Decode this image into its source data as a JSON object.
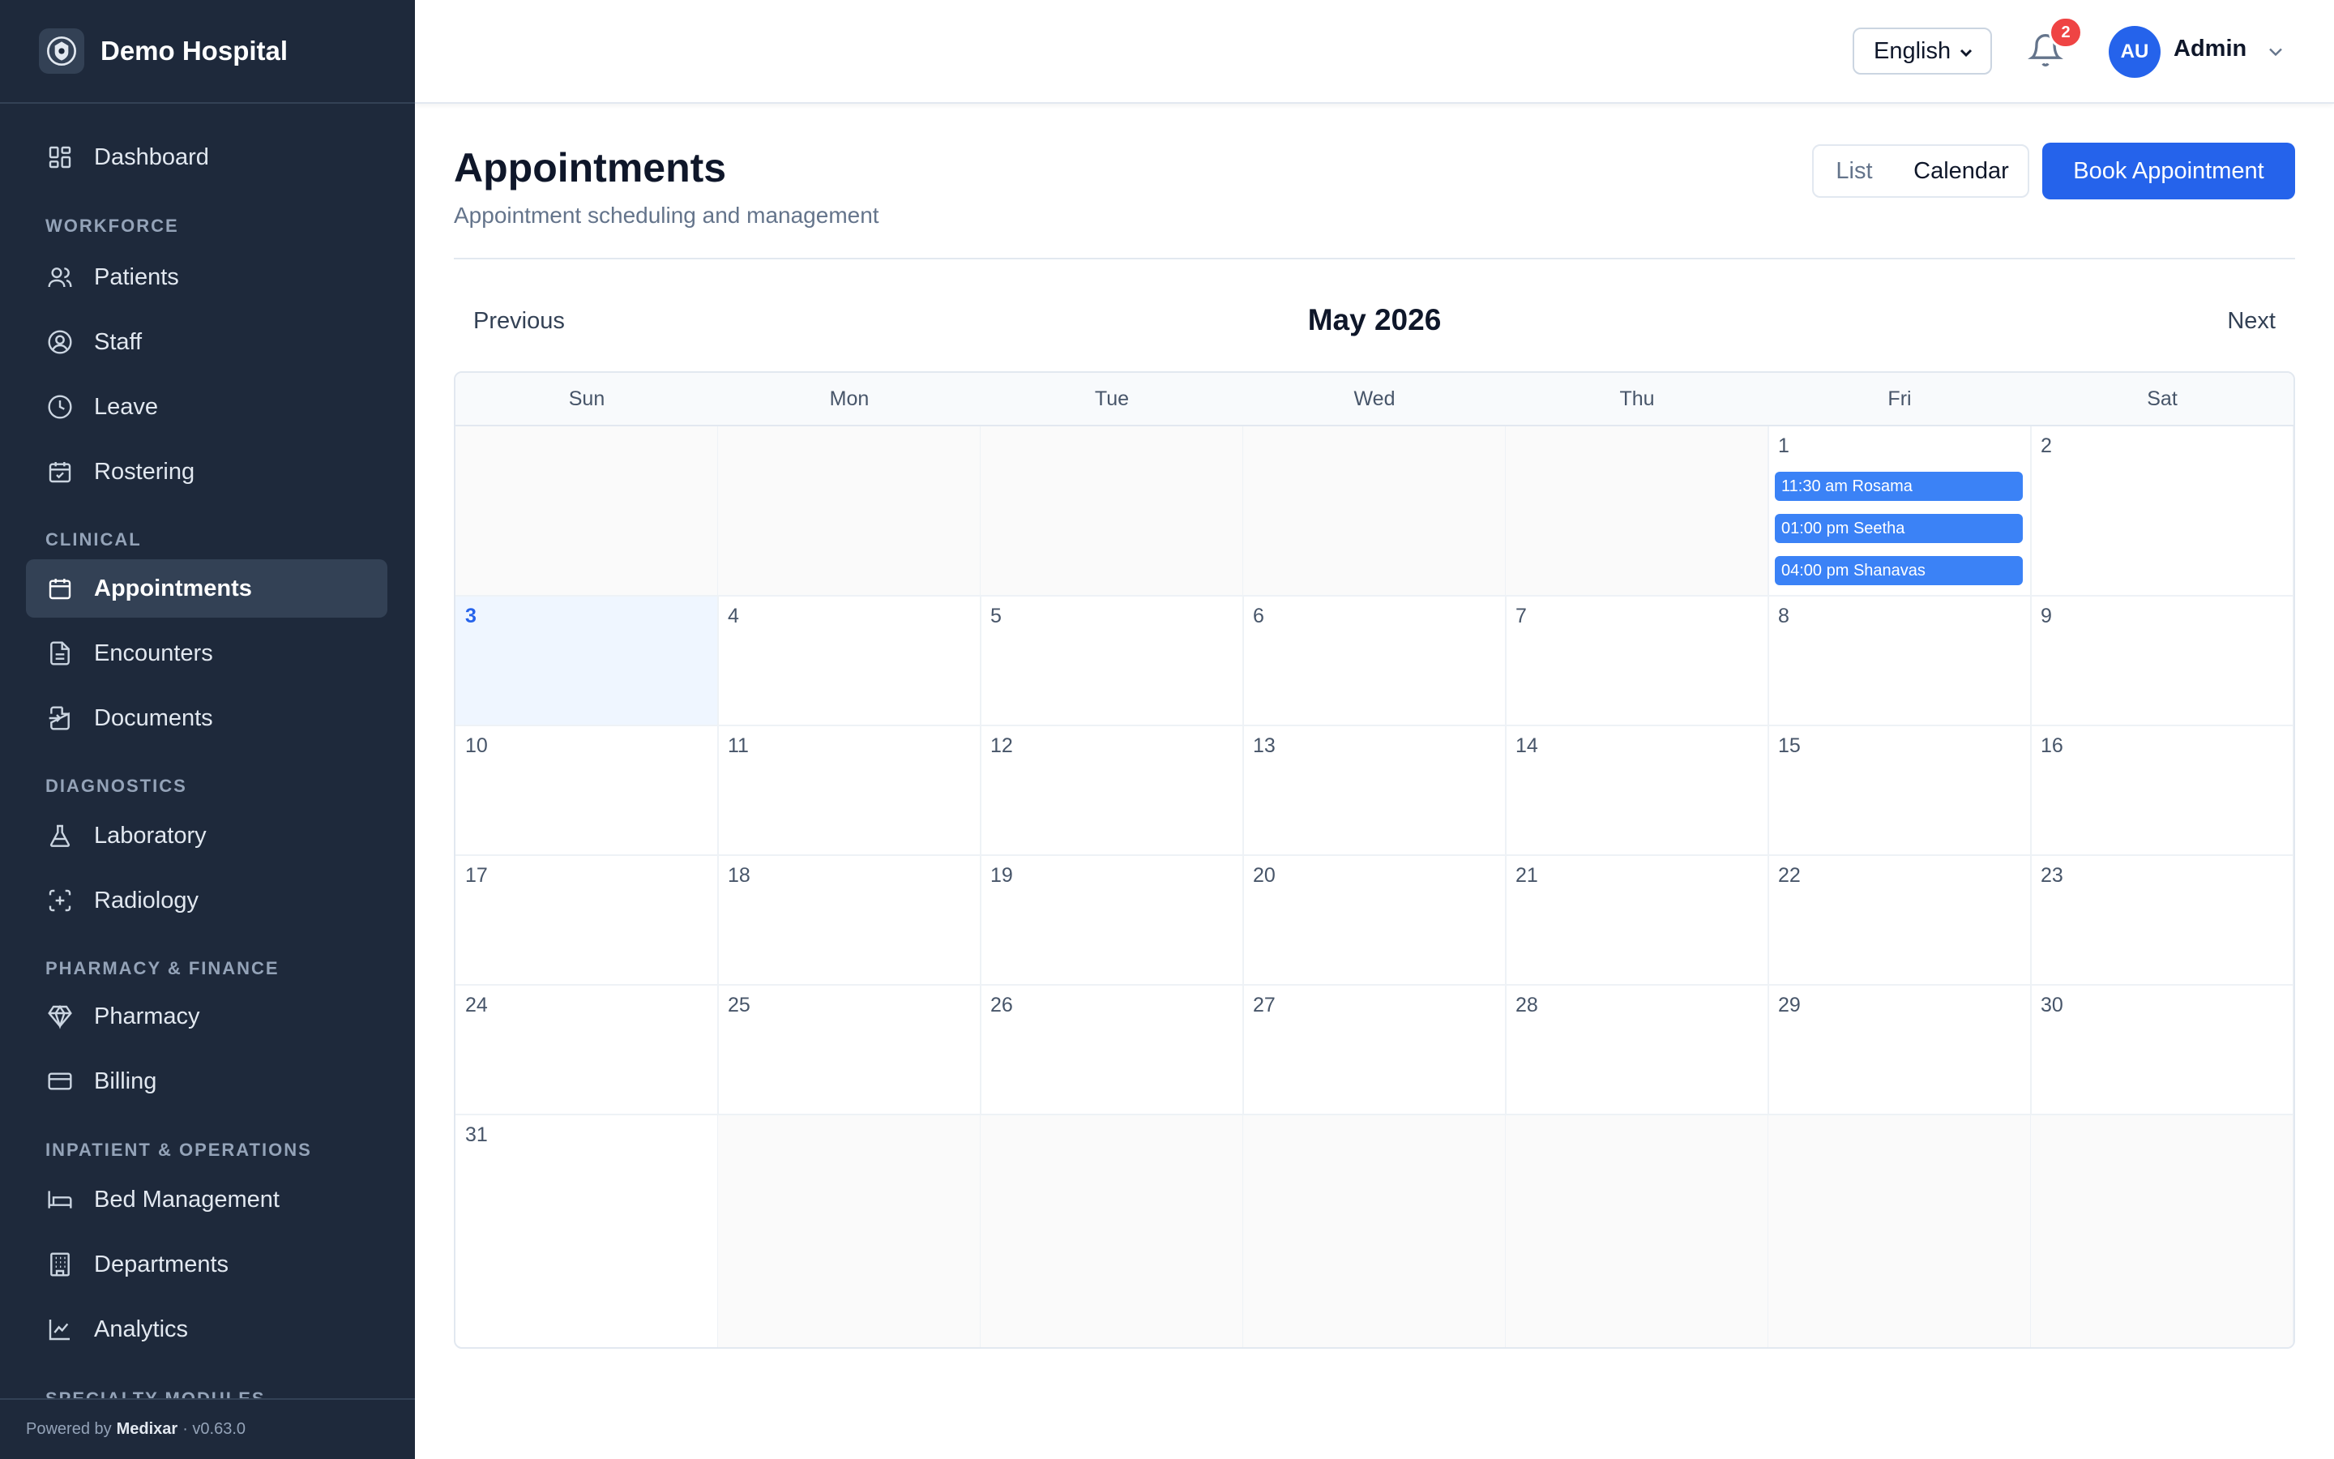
{
  "brand": {
    "name": "Demo Hospital"
  },
  "sidebar": {
    "items": [
      {
        "id": "dashboard",
        "label": "Dashboard",
        "icon": "grid-icon"
      },
      {
        "id": "patients",
        "label": "Patients",
        "icon": "users-icon"
      },
      {
        "id": "staff",
        "label": "Staff",
        "icon": "user-circle-icon"
      },
      {
        "id": "leave",
        "label": "Leave",
        "icon": "clock-icon"
      },
      {
        "id": "rostering",
        "label": "Rostering",
        "icon": "calendar-check-icon"
      },
      {
        "id": "appointments",
        "label": "Appointments",
        "icon": "calendar-icon",
        "active": true
      },
      {
        "id": "encounters",
        "label": "Encounters",
        "icon": "file-text-icon"
      },
      {
        "id": "documents",
        "label": "Documents",
        "icon": "file-import-icon"
      },
      {
        "id": "laboratory",
        "label": "Laboratory",
        "icon": "flask-icon"
      },
      {
        "id": "radiology",
        "label": "Radiology",
        "icon": "scan-icon"
      },
      {
        "id": "pharmacy",
        "label": "Pharmacy",
        "icon": "gem-icon"
      },
      {
        "id": "billing",
        "label": "Billing",
        "icon": "credit-card-icon"
      },
      {
        "id": "bed-management",
        "label": "Bed Management",
        "icon": "bed-icon"
      },
      {
        "id": "departments",
        "label": "Departments",
        "icon": "building-icon"
      },
      {
        "id": "analytics",
        "label": "Analytics",
        "icon": "chart-line-icon"
      }
    ],
    "sections": [
      "WORKFORCE",
      "CLINICAL",
      "DIAGNOSTICS",
      "PHARMACY & FINANCE",
      "INPATIENT & OPERATIONS",
      "SPECIALTY MODULES"
    ],
    "footer": {
      "prefix": "Powered by",
      "product": "Medixar",
      "version": "· v0.63.0"
    }
  },
  "header": {
    "language": "English",
    "notification_count": "2",
    "avatar_initials": "AU",
    "user_name": "Admin"
  },
  "page": {
    "title": "Appointments",
    "subtitle": "Appointment scheduling and management",
    "view_list": "List",
    "view_calendar": "Calendar",
    "book_button": "Book Appointment"
  },
  "calendar": {
    "month_label": "May 2026",
    "prev_label": "Previous",
    "next_label": "Next",
    "weekdays": [
      "Sun",
      "Mon",
      "Tue",
      "Wed",
      "Thu",
      "Fri",
      "Sat"
    ],
    "today": 3,
    "days_in_month": 31,
    "first_weekday_index": 5,
    "events": [
      {
        "day": 1,
        "label": "11:30 am Rosama"
      },
      {
        "day": 1,
        "label": "01:00 pm Seetha"
      },
      {
        "day": 1,
        "label": "04:00 pm Shanavas"
      }
    ]
  },
  "colors": {
    "sidebar_bg": "#1e293b",
    "accent": "#2563eb",
    "event": "#3b82f6",
    "badge": "#ef4444"
  }
}
